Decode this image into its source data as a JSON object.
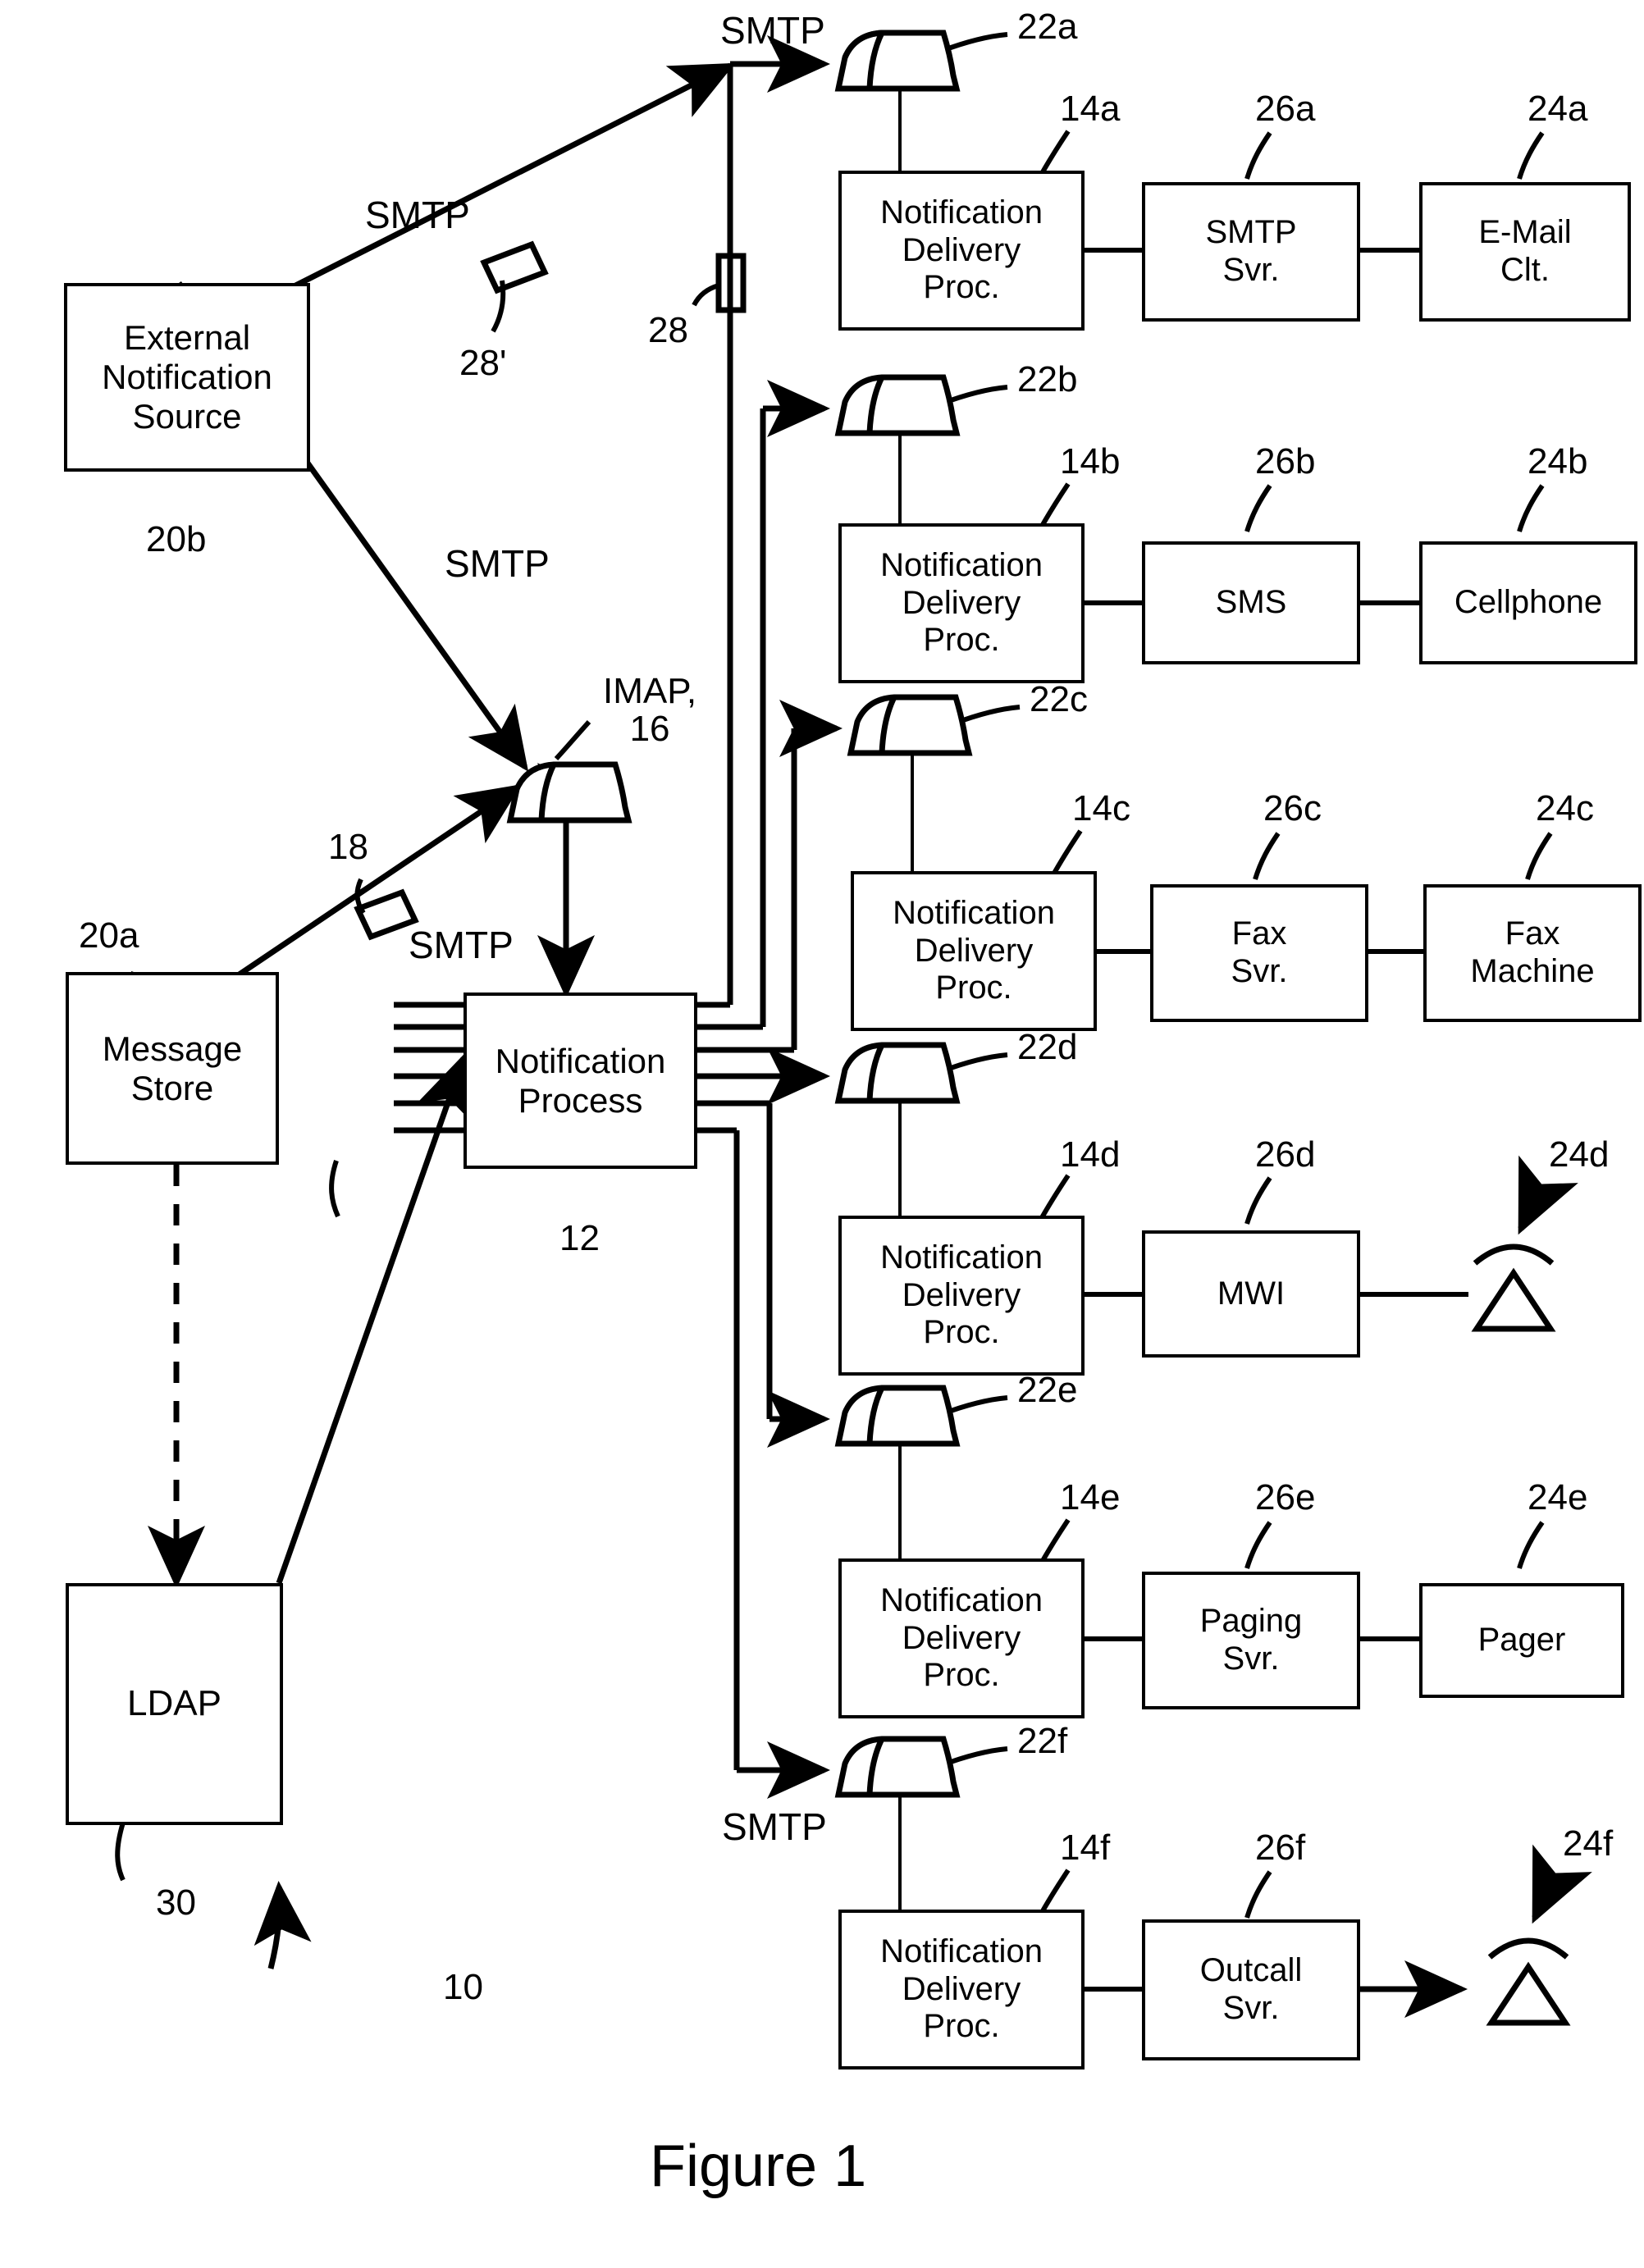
{
  "figure": {
    "caption": "Figure 1",
    "system_ref": "10"
  },
  "nodes": {
    "external_notification_source": {
      "lines": [
        "External",
        "Notification",
        "Source"
      ],
      "ref": "20b"
    },
    "message_store": {
      "lines": [
        "Message",
        "Store"
      ],
      "ref": "20a"
    },
    "notification_process": {
      "lines": [
        "Notification",
        "Process"
      ],
      "ref": "12"
    },
    "ldap": {
      "lines": [
        "LDAP"
      ],
      "ref": "30"
    }
  },
  "queues": [
    {
      "ref": "22a"
    },
    {
      "ref": "22b"
    },
    {
      "ref": "22c"
    },
    {
      "ref": "22d"
    },
    {
      "ref": "22e"
    },
    {
      "ref": "22f"
    }
  ],
  "imap_queue": {
    "label_line1": "IMAP,",
    "label_line2": "16"
  },
  "rows": [
    {
      "id": "a",
      "queue_ref": "22a",
      "delivery_proc": {
        "lines": [
          "Notification",
          "Delivery",
          "Proc."
        ],
        "ref": "14a"
      },
      "server": {
        "lines": [
          "SMTP",
          "Svr."
        ],
        "ref": "26a"
      },
      "endpoint": {
        "lines": [
          "E-Mail",
          "Clt."
        ],
        "ref": "24a",
        "type": "box"
      }
    },
    {
      "id": "b",
      "queue_ref": "22b",
      "delivery_proc": {
        "lines": [
          "Notification",
          "Delivery",
          "Proc."
        ],
        "ref": "14b"
      },
      "server": {
        "lines": [
          "SMS"
        ],
        "ref": "26b"
      },
      "endpoint": {
        "lines": [
          "Cellphone"
        ],
        "ref": "24b",
        "type": "box"
      }
    },
    {
      "id": "c",
      "queue_ref": "22c",
      "delivery_proc": {
        "lines": [
          "Notification",
          "Delivery",
          "Proc."
        ],
        "ref": "14c"
      },
      "server": {
        "lines": [
          "Fax",
          "Svr."
        ],
        "ref": "26c"
      },
      "endpoint": {
        "lines": [
          "Fax",
          "Machine"
        ],
        "ref": "24c",
        "type": "box"
      }
    },
    {
      "id": "d",
      "queue_ref": "22d",
      "delivery_proc": {
        "lines": [
          "Notification",
          "Delivery",
          "Proc."
        ],
        "ref": "14d"
      },
      "server": {
        "lines": [
          "MWI"
        ],
        "ref": "26d"
      },
      "endpoint": {
        "lines": [],
        "ref": "24d",
        "type": "lamp"
      }
    },
    {
      "id": "e",
      "queue_ref": "22e",
      "delivery_proc": {
        "lines": [
          "Notification",
          "Delivery",
          "Proc."
        ],
        "ref": "14e"
      },
      "server": {
        "lines": [
          "Paging",
          "Svr."
        ],
        "ref": "26e"
      },
      "endpoint": {
        "lines": [
          "Pager"
        ],
        "ref": "24e",
        "type": "box"
      }
    },
    {
      "id": "f",
      "queue_ref": "22f",
      "delivery_proc": {
        "lines": [
          "Notification",
          "Delivery",
          "Proc."
        ],
        "ref": "14f"
      },
      "server": {
        "lines": [
          "Outcall",
          "Svr."
        ],
        "ref": "26f"
      },
      "endpoint": {
        "lines": [],
        "ref": "24f",
        "type": "lamp"
      }
    }
  ],
  "protocol_labels": {
    "smtp_top": "SMTP",
    "smtp_ens_upper": "SMTP",
    "smtp_ens_lower": "SMTP",
    "smtp_message_store": "SMTP",
    "smtp_bottom": "SMTP"
  },
  "sensors": [
    {
      "ref": "28'",
      "kind": "tilted-tag"
    },
    {
      "ref": "28",
      "kind": "upright-tag"
    },
    {
      "ref": "18",
      "kind": "tilted-tag"
    }
  ],
  "colors": {
    "ink": "#000000",
    "paper": "#ffffff"
  }
}
